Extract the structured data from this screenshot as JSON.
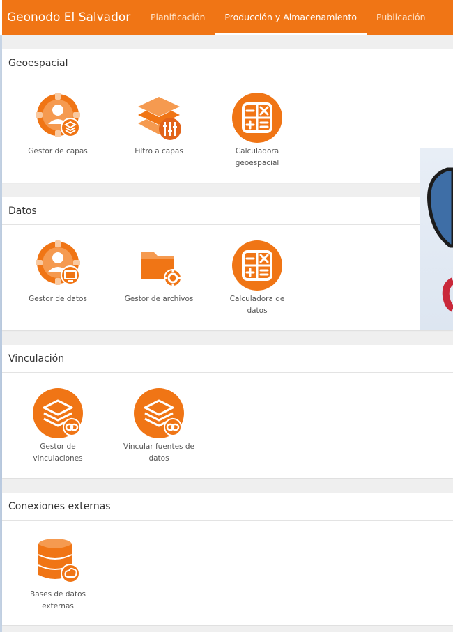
{
  "app": {
    "brand": "Geonodo El Salvador",
    "tabs": [
      {
        "label": "Planificación",
        "active": false
      },
      {
        "label": "Producción y Almacenamiento",
        "active": true
      },
      {
        "label": "Publicación",
        "active": false
      }
    ],
    "accent_color": "#f07515"
  },
  "sections": [
    {
      "title": "Geoespacial",
      "tools": [
        {
          "icon": "user-gear-layers-icon",
          "label": "Gestor de capas"
        },
        {
          "icon": "layers-filter-icon",
          "label": "Filtro a capas"
        },
        {
          "icon": "calculator-icon",
          "line1": "Calculadora",
          "line2": "geoespacial"
        }
      ]
    },
    {
      "title": "Datos",
      "tools": [
        {
          "icon": "user-gear-monitor-icon",
          "label": "Gestor de datos"
        },
        {
          "icon": "folder-gear-icon",
          "label": "Gestor de archivos"
        },
        {
          "icon": "calculator-icon",
          "line1": "Calculadora de",
          "line2": "datos"
        }
      ]
    },
    {
      "title": "Vinculación",
      "tools": [
        {
          "icon": "layers-link-icon",
          "line1": "Gestor de",
          "line2": "vinculaciones"
        },
        {
          "icon": "layers-link-icon",
          "line1": "Vincular fuentes de",
          "line2": "datos"
        }
      ]
    },
    {
      "title": "Conexiones externas",
      "tools": [
        {
          "icon": "database-cloud-icon",
          "line1": "Bases de datos",
          "line2": "externas"
        }
      ]
    }
  ]
}
